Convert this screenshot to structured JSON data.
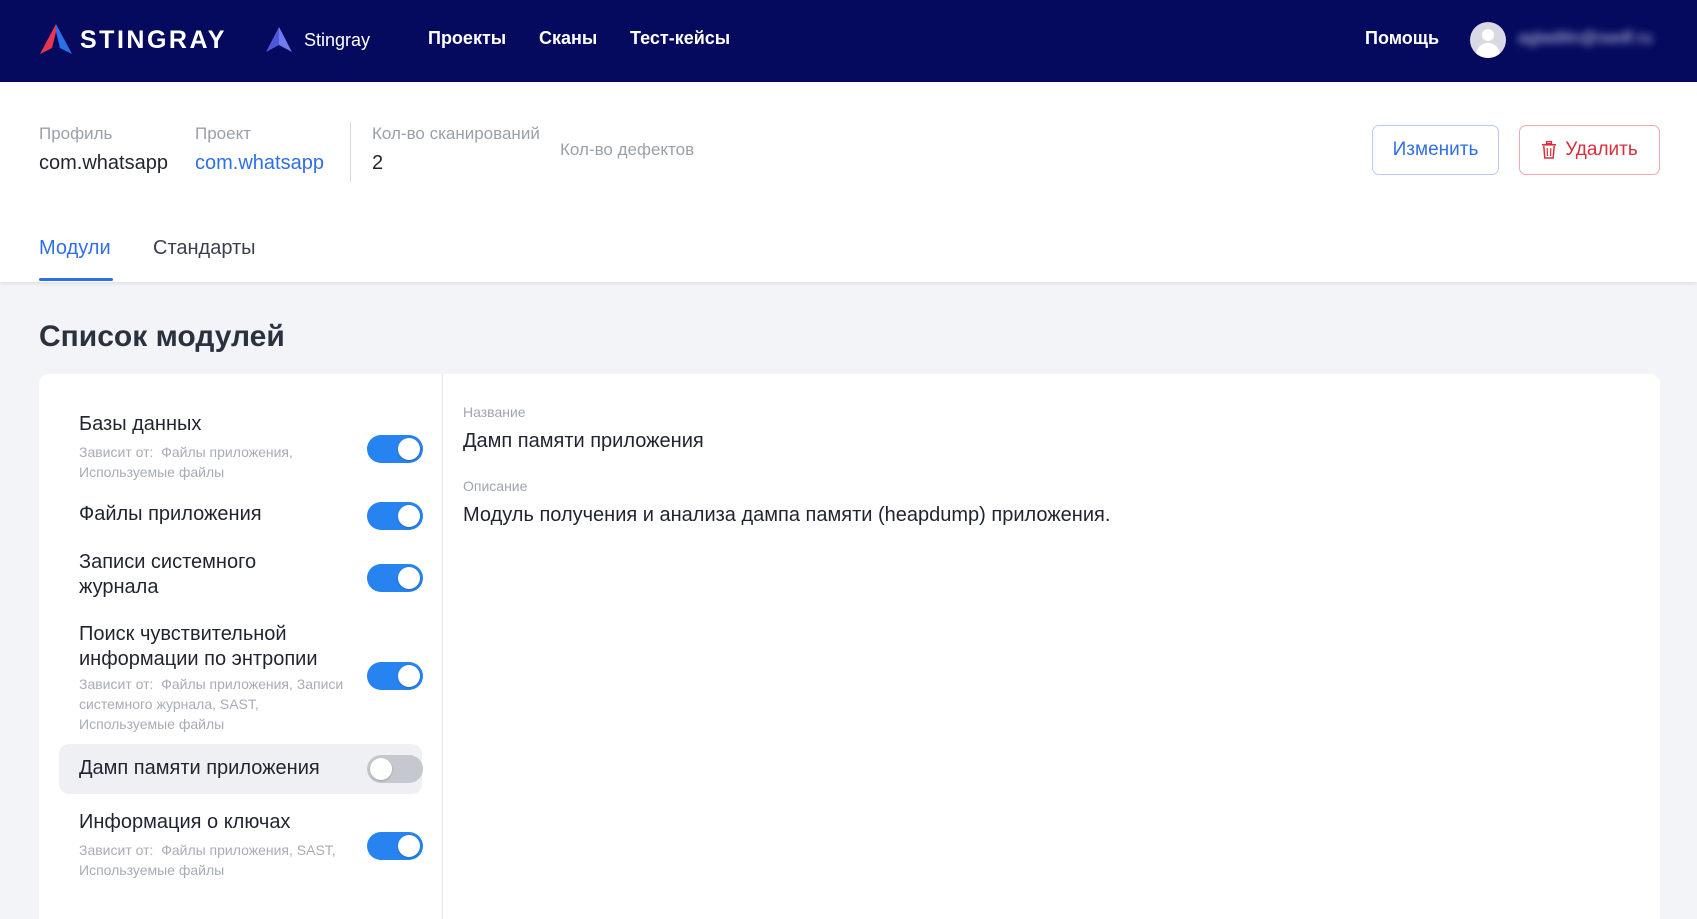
{
  "brand": {
    "name": "STINGRAY",
    "accent": "#e8344e",
    "nav_bg": "#050a5e",
    "primary": "#2f6fe6"
  },
  "nav": {
    "project_switch": "Stingray",
    "links": [
      "Проекты",
      "Сканы",
      "Тест-кейсы"
    ],
    "help": "Помощь",
    "user_email": "agladilin@swdf.ru",
    "avatar_icon": "user-avatar-icon"
  },
  "header": {
    "profile_label": "Профиль",
    "profile_value": "com.whatsapp",
    "project_label": "Проект",
    "project_value": "com.whatsapp",
    "scans_label": "Кол-во сканирований",
    "scans_value": "2",
    "defects_label": "Кол-во дефектов",
    "edit_button": "Изменить",
    "delete_button": "Удалить",
    "delete_icon": "trash-icon",
    "tabs": [
      {
        "label": "Модули",
        "active": true
      },
      {
        "label": "Стандарты",
        "active": false
      }
    ]
  },
  "page_title": "Список модулей",
  "modules": [
    {
      "name": "Базы данных",
      "deps_prefix": "Зависит от:",
      "deps": "Файлы приложения, Используемые файлы",
      "enabled": true
    },
    {
      "name": "Файлы приложения",
      "enabled": true
    },
    {
      "name": "Записи системного журнала",
      "enabled": true
    },
    {
      "name": "Поиск чувствительной информации по энтропии",
      "deps_prefix": "Зависит от:",
      "deps": "Файлы приложения, Записи системного журнала, SAST, Используемые файлы",
      "enabled": true
    },
    {
      "name": "Дамп памяти приложения",
      "enabled": false,
      "selected": true
    },
    {
      "name": "Информация о ключах",
      "deps_prefix": "Зависит от:",
      "deps": "Файлы приложения, SAST, Используемые файлы",
      "enabled": true
    }
  ],
  "detail": {
    "name_label": "Название",
    "name_value": "Дамп памяти приложения",
    "description_label": "Описание",
    "description_value": "Модуль получения и анализа дампа памяти (heapdump) приложения."
  }
}
